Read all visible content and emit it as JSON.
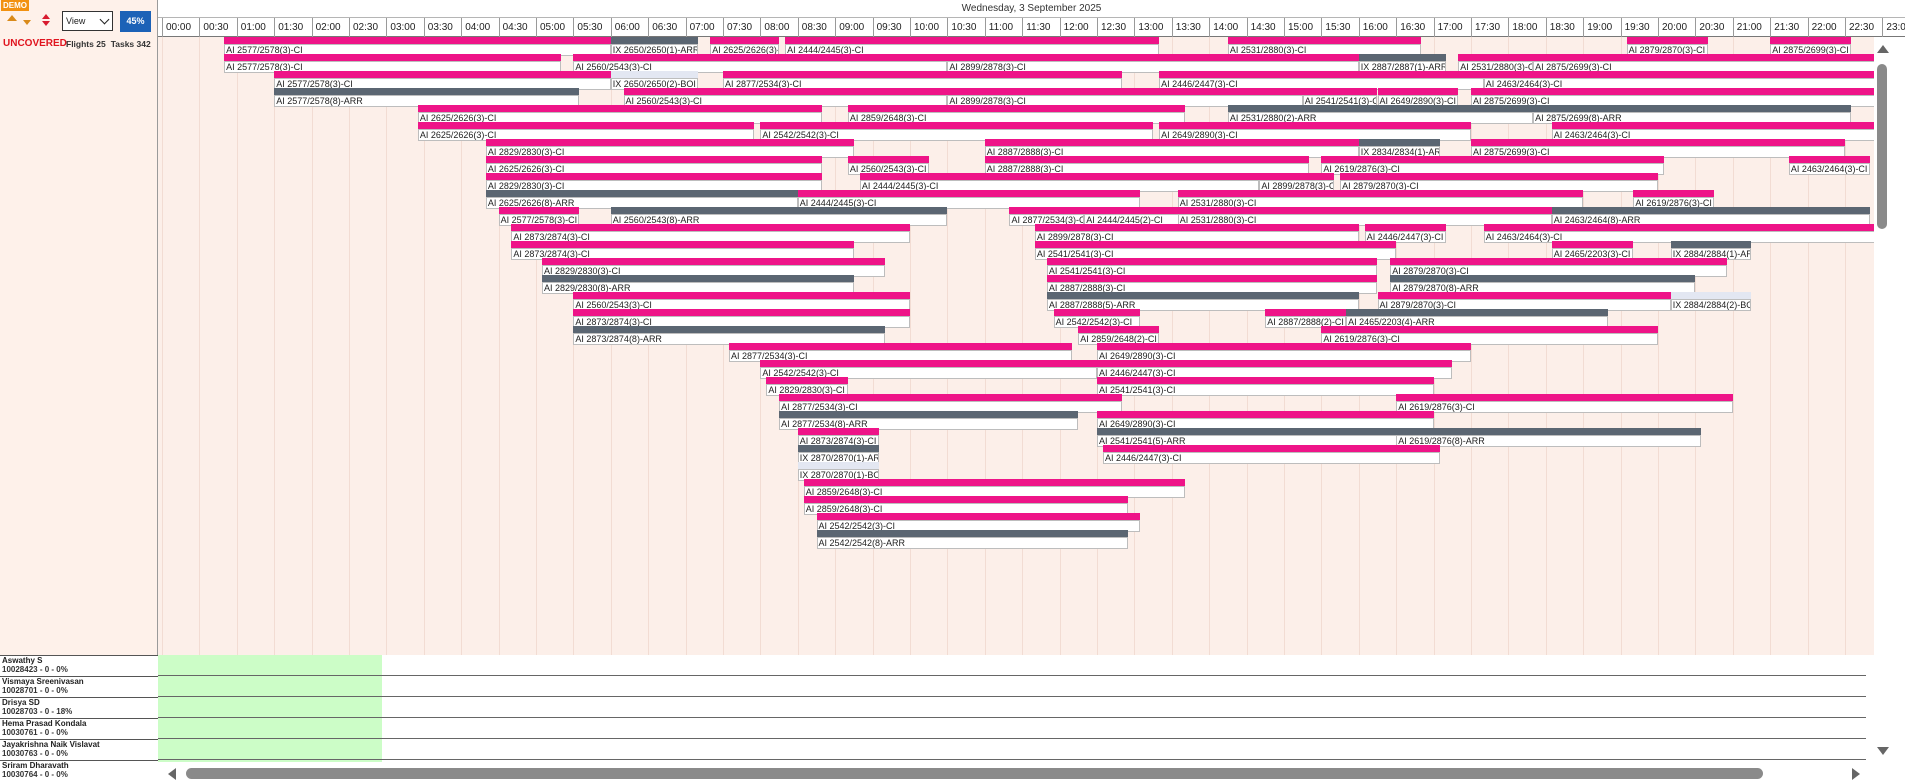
{
  "app": {
    "demo_badge": "DEMO",
    "view_select": "View",
    "percent": "45%",
    "uncovered": "UNCOVERED",
    "flights_label": "Flights 25",
    "tasks_label": "Tasks 342",
    "date_title": "Wednesday, 3 September 2025"
  },
  "times": [
    "00:00",
    "00:30",
    "01:00",
    "01:30",
    "02:00",
    "02:30",
    "03:00",
    "03:30",
    "04:00",
    "04:30",
    "05:00",
    "05:30",
    "06:00",
    "06:30",
    "07:00",
    "07:30",
    "08:00",
    "08:30",
    "09:00",
    "09:30",
    "10:00",
    "10:30",
    "11:00",
    "11:30",
    "12:00",
    "12:30",
    "13:00",
    "13:30",
    "14:00",
    "14:30",
    "15:00",
    "15:30",
    "16:00",
    "16:30",
    "17:00",
    "17:30",
    "18:00",
    "18:30",
    "19:00",
    "19:30",
    "20:00",
    "20:30",
    "21:00",
    "21:30",
    "22:00",
    "22:30",
    "23:00"
  ],
  "staff": [
    {
      "name": "Aswathy S",
      "code": "10028423 - 0 - 0%"
    },
    {
      "name": "Vismaya Sreenivasan",
      "code": "10028701 - 0 - 0%"
    },
    {
      "name": "Drisya SD",
      "code": "10028703 - 0 - 18%"
    },
    {
      "name": "Hema Prasad Kondala",
      "code": "10030761 - 0 - 0%"
    },
    {
      "name": "Jayakrishna Naik Vislavat",
      "code": "10030763 - 0 - 0%"
    },
    {
      "name": "Sriram Dharavath",
      "code": "10030764 - 0 - 0%"
    }
  ],
  "colors": {
    "pink": "#ee1488",
    "gray": "#5b6672",
    "light": "#e3e7f2",
    "body": "#fcefe9",
    "staff_available": "#ccfdc7"
  },
  "tasks": [
    [
      0,
      0.83,
      6.0,
      "p",
      "AI 2577/2578(3)-CI"
    ],
    [
      0,
      6.0,
      7.17,
      "g",
      "IX 2650/2650(1)-ARR"
    ],
    [
      0,
      7.33,
      8.25,
      "p",
      "AI 2625/2626(3)-CI"
    ],
    [
      0,
      8.33,
      13.33,
      "p",
      "AI 2444/2445(3)-CI"
    ],
    [
      0,
      14.25,
      16.83,
      "p",
      "AI 2531/2880(3)-CI"
    ],
    [
      0,
      19.58,
      20.67,
      "p",
      "AI 2879/2870(3)-CI"
    ],
    [
      0,
      21.5,
      22.58,
      "p",
      "AI 2875/2699(3)-CI"
    ],
    [
      1,
      0.83,
      5.33,
      "p",
      "AI 2577/2578(3)-CI"
    ],
    [
      1,
      5.5,
      10.5,
      "p",
      "AI 2560/2543(3)-CI"
    ],
    [
      1,
      10.5,
      16.0,
      "p",
      "AI 2899/2878(3)-CI"
    ],
    [
      1,
      16.0,
      17.17,
      "g",
      "IX 2887/2887(1)-ARR"
    ],
    [
      1,
      17.33,
      18.33,
      "p",
      "AI 2531/2880(3)-CI"
    ],
    [
      1,
      18.33,
      23.5,
      "p",
      "AI 2875/2699(3)-CI"
    ],
    [
      2,
      1.5,
      6.0,
      "p",
      "AI 2577/2578(3)-CI"
    ],
    [
      2,
      6.0,
      7.17,
      "l",
      "IX 2650/2650(2)-BOI"
    ],
    [
      2,
      7.5,
      12.83,
      "p",
      "AI 2877/2534(3)-CI"
    ],
    [
      2,
      13.33,
      17.67,
      "p",
      "AI 2446/2447(3)-CI"
    ],
    [
      2,
      17.67,
      23.5,
      "p",
      "AI 2463/2464(3)-CI"
    ],
    [
      3,
      1.5,
      5.58,
      "g",
      "AI 2577/2578(8)-ARR"
    ],
    [
      3,
      6.17,
      10.5,
      "p",
      "AI 2560/2543(3)-CI"
    ],
    [
      3,
      10.5,
      15.25,
      "p",
      "AI 2899/2878(3)-CI"
    ],
    [
      3,
      15.25,
      16.25,
      "p",
      "AI 2541/2541(3)-CI"
    ],
    [
      3,
      16.25,
      17.33,
      "p",
      "AI 2649/2890(3)-CI"
    ],
    [
      3,
      17.5,
      23.5,
      "p",
      "AI 2875/2699(3)-CI"
    ],
    [
      4,
      3.42,
      8.83,
      "p",
      "AI 2625/2626(3)-CI"
    ],
    [
      4,
      9.17,
      13.67,
      "p",
      "AI 2859/2648(3)-CI"
    ],
    [
      4,
      14.25,
      18.33,
      "g",
      "AI 2531/2880(2)-ARR"
    ],
    [
      4,
      18.33,
      22.58,
      "g",
      "AI 2875/2699(8)-ARR"
    ],
    [
      5,
      3.42,
      7.92,
      "p",
      "AI 2625/2626(3)-CI"
    ],
    [
      5,
      8.0,
      13.25,
      "p",
      "AI 2542/2542(3)-CI"
    ],
    [
      5,
      13.33,
      17.5,
      "p",
      "AI 2649/2890(3)-CI"
    ],
    [
      5,
      18.58,
      23.5,
      "p",
      "AI 2463/2464(3)-CI"
    ],
    [
      6,
      4.33,
      9.25,
      "p",
      "AI 2829/2830(3)-CI"
    ],
    [
      6,
      11.0,
      16.0,
      "p",
      "AI 2887/2888(3)-CI"
    ],
    [
      6,
      16.0,
      17.08,
      "g",
      "IX 2834/2834(1)-ARR"
    ],
    [
      6,
      17.5,
      22.5,
      "p",
      "AI 2875/2699(3)-CI"
    ],
    [
      7,
      4.33,
      8.83,
      "p",
      "AI 2625/2626(3)-CI"
    ],
    [
      7,
      9.17,
      10.25,
      "p",
      "AI 2560/2543(3)-CI"
    ],
    [
      7,
      11.0,
      15.33,
      "p",
      "AI 2887/2888(3)-CI"
    ],
    [
      7,
      15.5,
      20.08,
      "p",
      "AI 2619/2876(3)-CI"
    ],
    [
      7,
      21.75,
      22.83,
      "p",
      "AI 2463/2464(3)-CI"
    ],
    [
      8,
      4.33,
      8.83,
      "p",
      "AI 2829/2830(3)-CI"
    ],
    [
      8,
      9.33,
      14.67,
      "p",
      "AI 2444/2445(3)-CI"
    ],
    [
      8,
      14.67,
      15.67,
      "p",
      "AI 2899/2878(3)-CI"
    ],
    [
      8,
      15.75,
      20.0,
      "p",
      "AI 2879/2870(3)-CI"
    ],
    [
      9,
      4.33,
      8.5,
      "g",
      "AI 2625/2626(8)-ARR"
    ],
    [
      9,
      8.5,
      13.08,
      "p",
      "AI 2444/2445(3)-CI"
    ],
    [
      9,
      13.58,
      19.0,
      "p",
      "AI 2531/2880(3)-CI"
    ],
    [
      9,
      19.67,
      20.75,
      "p",
      "AI 2619/2876(3)-CI"
    ],
    [
      10,
      4.5,
      5.58,
      "p",
      "AI 2577/2578(3)-CI"
    ],
    [
      10,
      6.0,
      10.5,
      "g",
      "AI 2560/2543(8)-ARR"
    ],
    [
      10,
      11.33,
      12.33,
      "p",
      "AI 2877/2534(3)-CI"
    ],
    [
      10,
      12.33,
      13.67,
      "p",
      "AI 2444/2445(2)-CI"
    ],
    [
      10,
      13.58,
      18.58,
      "p",
      "AI 2531/2880(3)-CI"
    ],
    [
      10,
      18.58,
      22.83,
      "g",
      "AI 2463/2464(8)-ARR"
    ],
    [
      11,
      4.67,
      10.0,
      "p",
      "AI 2873/2874(3)-CI"
    ],
    [
      11,
      11.67,
      16.0,
      "p",
      "AI 2899/2878(3)-CI"
    ],
    [
      11,
      16.08,
      17.17,
      "p",
      "AI 2446/2447(3)-CI"
    ],
    [
      11,
      17.67,
      23.0,
      "p",
      "AI 2463/2464(3)-CI"
    ],
    [
      12,
      4.67,
      9.25,
      "p",
      "AI 2873/2874(3)-CI"
    ],
    [
      12,
      11.67,
      16.5,
      "p",
      "AI 2541/2541(3)-CI"
    ],
    [
      12,
      18.58,
      19.67,
      "p",
      "AI 2465/2203(3)-CI"
    ],
    [
      12,
      20.17,
      21.25,
      "g",
      "IX 2884/2884(1)-ARR"
    ],
    [
      13,
      5.08,
      9.67,
      "p",
      "AI 2829/2830(3)-CI"
    ],
    [
      13,
      11.83,
      16.25,
      "p",
      "AI 2541/2541(3)-CI"
    ],
    [
      13,
      16.42,
      20.92,
      "p",
      "AI 2879/2870(3)-CI"
    ],
    [
      14,
      5.08,
      9.25,
      "g",
      "AI 2829/2830(8)-ARR"
    ],
    [
      14,
      11.83,
      16.25,
      "p",
      "AI 2887/2888(3)-CI"
    ],
    [
      14,
      16.42,
      20.5,
      "g",
      "AI 2879/2870(8)-ARR"
    ],
    [
      15,
      5.5,
      10.0,
      "p",
      "AI 2560/2543(3)-CI"
    ],
    [
      15,
      11.83,
      16.0,
      "g",
      "AI 2887/2888(5)-ARR"
    ],
    [
      15,
      16.25,
      20.17,
      "p",
      "AI 2879/2870(3)-CI"
    ],
    [
      15,
      20.17,
      21.25,
      "l",
      "IX 2884/2884(2)-BOI"
    ],
    [
      16,
      5.5,
      10.0,
      "p",
      "AI 2873/2874(3)-CI"
    ],
    [
      16,
      11.92,
      13.08,
      "p",
      "AI 2542/2542(3)-CI"
    ],
    [
      16,
      14.75,
      15.83,
      "p",
      "AI 2887/2888(2)-CI"
    ],
    [
      16,
      15.83,
      19.33,
      "g",
      "AI 2465/2203(4)-ARR"
    ],
    [
      17,
      5.5,
      9.67,
      "g",
      "AI 2873/2874(8)-ARR"
    ],
    [
      17,
      12.25,
      13.33,
      "p",
      "AI 2859/2648(2)-CI"
    ],
    [
      17,
      15.5,
      20.0,
      "p",
      "AI 2619/2876(3)-CI"
    ],
    [
      18,
      7.58,
      12.17,
      "p",
      "AI 2877/2534(3)-CI"
    ],
    [
      18,
      12.5,
      17.5,
      "p",
      "AI 2649/2890(3)-CI"
    ],
    [
      19,
      8.0,
      12.5,
      "p",
      "AI 2542/2542(3)-CI"
    ],
    [
      19,
      12.5,
      17.25,
      "p",
      "AI 2446/2447(3)-CI"
    ],
    [
      20,
      8.08,
      9.17,
      "p",
      "AI 2829/2830(3)-CI"
    ],
    [
      20,
      12.5,
      17.0,
      "p",
      "AI 2541/2541(3)-CI"
    ],
    [
      21,
      8.25,
      12.83,
      "p",
      "AI 2877/2534(3)-CI"
    ],
    [
      21,
      16.5,
      21.0,
      "p",
      "AI 2619/2876(3)-CI"
    ],
    [
      22,
      8.25,
      12.25,
      "g",
      "AI 2877/2534(8)-ARR"
    ],
    [
      22,
      12.5,
      17.0,
      "p",
      "AI 2649/2890(3)-CI"
    ],
    [
      23,
      8.5,
      9.58,
      "p",
      "AI 2873/2874(3)-CI"
    ],
    [
      23,
      12.5,
      16.58,
      "g",
      "AI 2541/2541(5)-ARR"
    ],
    [
      23,
      16.5,
      20.58,
      "g",
      "AI 2619/2876(8)-ARR"
    ],
    [
      24,
      8.5,
      9.58,
      "g",
      "IX 2870/2870(1)-ARR"
    ],
    [
      24,
      12.58,
      17.08,
      "p",
      "AI 2446/2447(3)-CI"
    ],
    [
      25,
      8.5,
      9.58,
      "l",
      "IX 2870/2870(1)-BOI"
    ],
    [
      26,
      8.58,
      13.67,
      "p",
      "AI 2859/2648(3)-CI"
    ],
    [
      27,
      8.58,
      12.92,
      "p",
      "AI 2859/2648(3)-CI"
    ],
    [
      28,
      8.75,
      13.08,
      "p",
      "AI 2542/2542(3)-CI"
    ],
    [
      29,
      8.75,
      12.92,
      "g",
      "AI 2542/2542(8)-ARR"
    ]
  ]
}
